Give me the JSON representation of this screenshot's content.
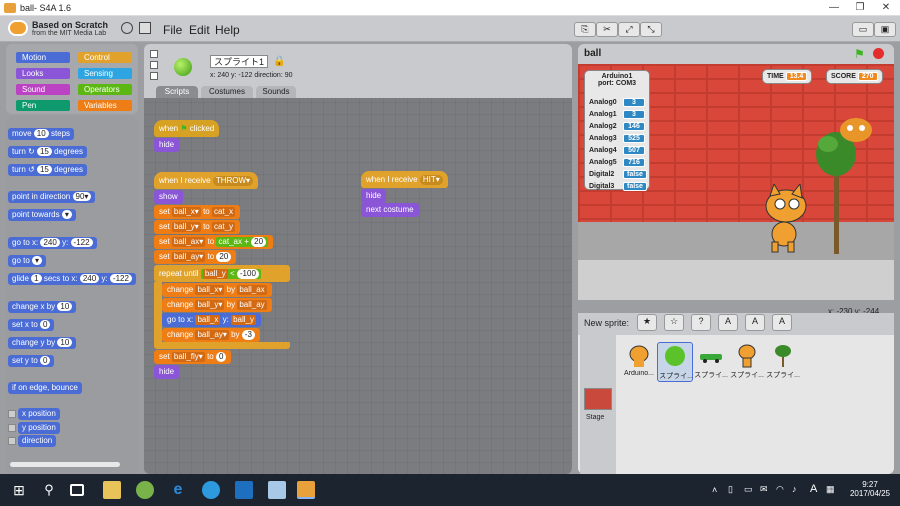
{
  "window": {
    "title": "ball- S4A 1.6",
    "controls": [
      "—",
      "❐",
      "✕"
    ]
  },
  "logo": {
    "line1": "Based on Scratch",
    "line2": "from the MIT Media Lab"
  },
  "menu": [
    "File",
    "Edit",
    "Help"
  ],
  "categories": [
    {
      "label": "Motion",
      "color": "#4a6cd4"
    },
    {
      "label": "Control",
      "color": "#e0a22b"
    },
    {
      "label": "Looks",
      "color": "#8a55d7"
    },
    {
      "label": "Sensing",
      "color": "#2ca5e2"
    },
    {
      "label": "Sound",
      "color": "#bb42c3"
    },
    {
      "label": "Operators",
      "color": "#5cb712"
    },
    {
      "label": "Pen",
      "color": "#0e9a6c"
    },
    {
      "label": "Variables",
      "color": "#ee7d16"
    }
  ],
  "palette_blocks": {
    "move": {
      "a": "move",
      "n": "10",
      "b": "steps"
    },
    "turn_r": {
      "a": "turn ↻",
      "n": "15",
      "b": "degrees"
    },
    "turn_l": {
      "a": "turn ↺",
      "n": "15",
      "b": "degrees"
    },
    "point_dir": {
      "a": "point in direction",
      "n": "90▾"
    },
    "point_towards": {
      "a": "point towards"
    },
    "goto_xy": {
      "a": "go to x:",
      "x": "240",
      "b": "y:",
      "y": "-122"
    },
    "goto": {
      "a": "go to"
    },
    "glide": {
      "a": "glide",
      "n": "1",
      "b": "secs to x:",
      "x": "240",
      "c": "y:",
      "y": "-122"
    },
    "change_x": {
      "a": "change x by",
      "n": "10"
    },
    "set_x": {
      "a": "set x to",
      "n": "0"
    },
    "change_y": {
      "a": "change y by",
      "n": "10"
    },
    "set_y": {
      "a": "set y to",
      "n": "0"
    },
    "bounce": {
      "a": "if on edge, bounce"
    },
    "rep_x": "x position",
    "rep_y": "y position",
    "rep_dir": "direction"
  },
  "sprite": {
    "name": "スプライト1",
    "info": "x: 240  y: -122  direction: 90"
  },
  "tabs": [
    "Scripts",
    "Costumes",
    "Sounds"
  ],
  "script1": {
    "hat_a": "when",
    "hat_b": "clicked",
    "hide": "hide"
  },
  "script2": {
    "hat": "when I receive",
    "msg": "THROW▾",
    "show": "show",
    "set": "set",
    "to": "to",
    "by": "by",
    "change": "change",
    "v_bx": "ball_x▾",
    "v_by": "ball_y▾",
    "v_bax": "ball_ax▾",
    "v_bay": "ball_ay▾",
    "v_bfly": "ball_fly▾",
    "r_catx": "cat_x",
    "r_caty": "cat_y",
    "r_catax": "cat_ax",
    "plus": "+",
    "n20a": "20",
    "n20b": "20",
    "repeat": "repeat until",
    "lt_v": "ball_y",
    "lt": "<",
    "lt_n": "-100",
    "r_bax": "ball_ax",
    "r_bay": "ball_ay",
    "gx": "go to x:",
    "gy": "y:",
    "r_bx": "ball_x",
    "r_by": "ball_y",
    "n_m3": "-3",
    "n0": "0",
    "hide": "hide"
  },
  "script3": {
    "hat": "when I receive",
    "msg": "HIT▾",
    "hide": "hide",
    "next": "next costume"
  },
  "stage": {
    "title": "ball",
    "coords": "x: -230  y: -244",
    "time_label": "TIME",
    "time_value": "13.4",
    "score_label": "SCORE",
    "score_value": "270"
  },
  "arduino": {
    "title": "Arduino1",
    "port": "port: COM3",
    "rows": [
      [
        "Analog0",
        "3"
      ],
      [
        "Analog1",
        "3"
      ],
      [
        "Analog2",
        "146"
      ],
      [
        "Analog3",
        "525"
      ],
      [
        "Analog4",
        "507"
      ],
      [
        "Analog5",
        "716"
      ],
      [
        "Digital2",
        "false"
      ],
      [
        "Digital3",
        "false"
      ]
    ]
  },
  "newsprite_label": "New sprite:",
  "sprites": [
    {
      "label": "Arduino..."
    },
    {
      "label": "スプライ..."
    },
    {
      "label": "スプライ..."
    },
    {
      "label": "スプライ..."
    },
    {
      "label": "スプライ..."
    }
  ],
  "stage_thumb_label": "Stage",
  "clock": {
    "time": "9:27",
    "date": "2017/04/25"
  },
  "tray_lang": "A"
}
